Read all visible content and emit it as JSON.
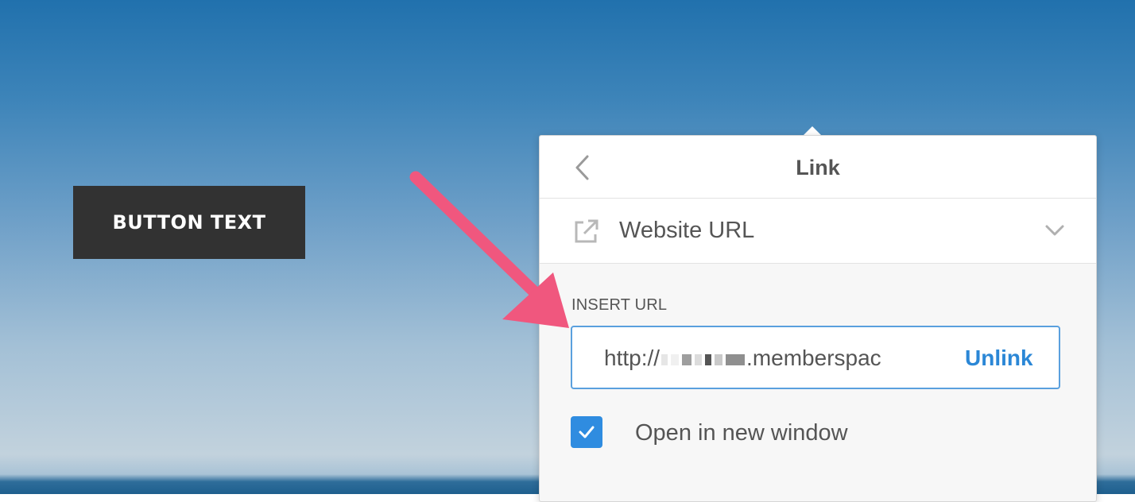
{
  "canvas": {
    "button_label": "BUTTON TEXT"
  },
  "link_panel": {
    "title": "Link",
    "link_type": {
      "icon": "external-link-icon",
      "selected": "Website URL"
    },
    "url_field": {
      "label": "INSERT URL",
      "value_prefix": "http://",
      "value_suffix": ".memberspac",
      "action_label": "Unlink"
    },
    "open_new_window": {
      "label": "Open in new window",
      "checked": true
    }
  },
  "annotation": {
    "arrow_color": "#f0577e"
  },
  "colors": {
    "accent_blue": "#2f8ce0",
    "button_dark": "#323232"
  }
}
